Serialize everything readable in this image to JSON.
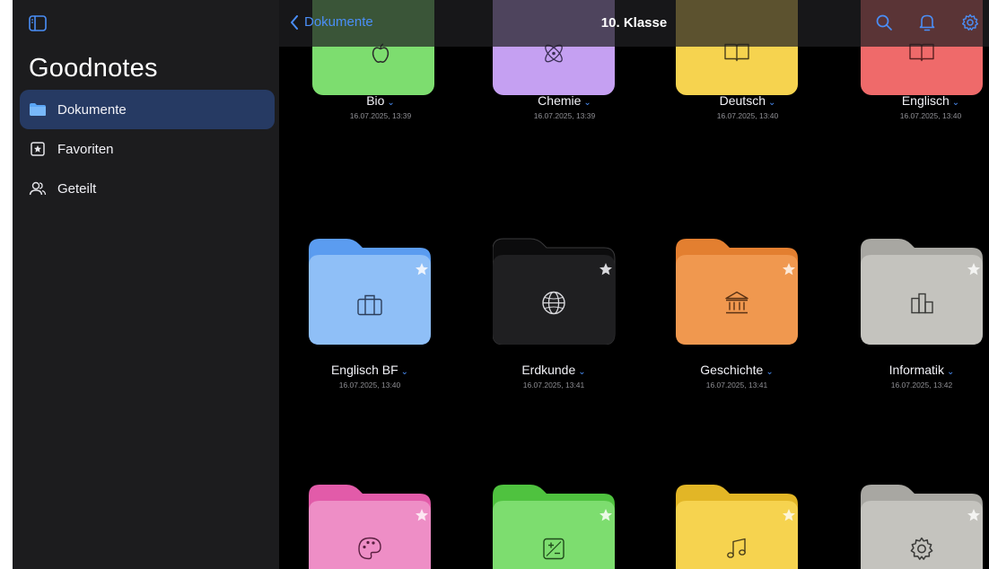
{
  "sidebar": {
    "app_title": "Goodnotes",
    "items": [
      {
        "label": "Dokumente",
        "icon": "folder-icon",
        "active": true
      },
      {
        "label": "Favoriten",
        "icon": "bookmark-star-icon",
        "active": false
      },
      {
        "label": "Geteilt",
        "icon": "people-icon",
        "active": false
      }
    ]
  },
  "header": {
    "back_label": "Dokumente",
    "title": "10. Klasse",
    "actions": [
      "search-icon",
      "bell-icon",
      "gear-icon"
    ]
  },
  "folders": [
    {
      "name": "Bio",
      "date": "16.07.2025, 13:39",
      "color": "#7ddd6f",
      "icon": "apple-icon"
    },
    {
      "name": "Chemie",
      "date": "16.07.2025, 13:39",
      "color": "#c5a0f2",
      "icon": "atom-icon"
    },
    {
      "name": "Deutsch",
      "date": "16.07.2025, 13:40",
      "color": "#f6d34f",
      "icon": "book-icon"
    },
    {
      "name": "Englisch",
      "date": "16.07.2025, 13:40",
      "color": "#ef6a6a",
      "icon": "book-icon"
    },
    {
      "name": "Englisch BF",
      "date": "16.07.2025, 13:40",
      "color": "#8fbff7",
      "icon": "briefcase-icon"
    },
    {
      "name": "Erdkunde",
      "date": "16.07.2025, 13:41",
      "color": "#1f1f21",
      "icon": "globe-icon"
    },
    {
      "name": "Geschichte",
      "date": "16.07.2025, 13:41",
      "color": "#f0984f",
      "icon": "museum-icon"
    },
    {
      "name": "Informatik",
      "date": "16.07.2025, 13:42",
      "color": "#c4c3be",
      "icon": "buildings-icon"
    },
    {
      "name": "",
      "date": "",
      "color": "#ee8ec6",
      "icon": "palette-icon"
    },
    {
      "name": "",
      "date": "",
      "color": "#7ddd6f",
      "icon": "plus-minus-icon"
    },
    {
      "name": "",
      "date": "",
      "color": "#f6d34f",
      "icon": "music-note-icon"
    },
    {
      "name": "",
      "date": "",
      "color": "#c4c3be",
      "icon": "gear-icon"
    }
  ],
  "colors": {
    "accent": "#4a8ef7",
    "sidebar_bg": "#1c1c1e",
    "active_item_bg": "#263a63"
  }
}
